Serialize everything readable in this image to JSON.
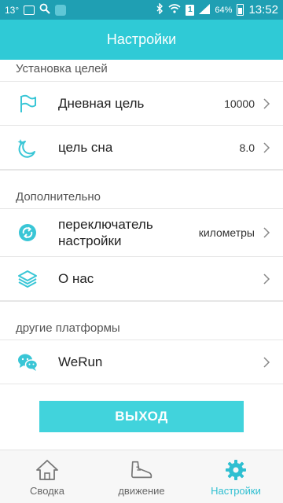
{
  "status_bar": {
    "temperature": "13°",
    "battery": "64%",
    "time": "13:52",
    "sim": "1"
  },
  "header": {
    "title": "Настройки"
  },
  "sections": {
    "goals": {
      "title": "Установка целей",
      "daily_goal": {
        "label": "Дневная цель",
        "value": "10000",
        "icon": "flag-icon"
      },
      "sleep_goal": {
        "label": "цель сна",
        "value": "8.0",
        "icon": "moon-icon"
      }
    },
    "additional": {
      "title": "Дополнительно",
      "unit_switch": {
        "label_line1": "переключатель",
        "label_line2": "настройки",
        "value": "километры",
        "icon": "switch-icon"
      },
      "about": {
        "label": "О нас",
        "icon": "layers-icon"
      }
    },
    "platforms": {
      "title": "другие платформы",
      "werun": {
        "label": "WeRun",
        "icon": "wechat-icon"
      }
    }
  },
  "logout_label": "ВЫХОД",
  "tabs": [
    {
      "label": "Сводка",
      "icon": "home-icon",
      "active": false
    },
    {
      "label": "движение",
      "icon": "shoe-icon",
      "active": false
    },
    {
      "label": "Настройки",
      "icon": "gear-icon",
      "active": true
    }
  ],
  "colors": {
    "accent": "#2fcad6",
    "status_bar": "#1f9fb3",
    "logout_button": "#41d3dc",
    "active_tab": "#2fbfd1"
  }
}
